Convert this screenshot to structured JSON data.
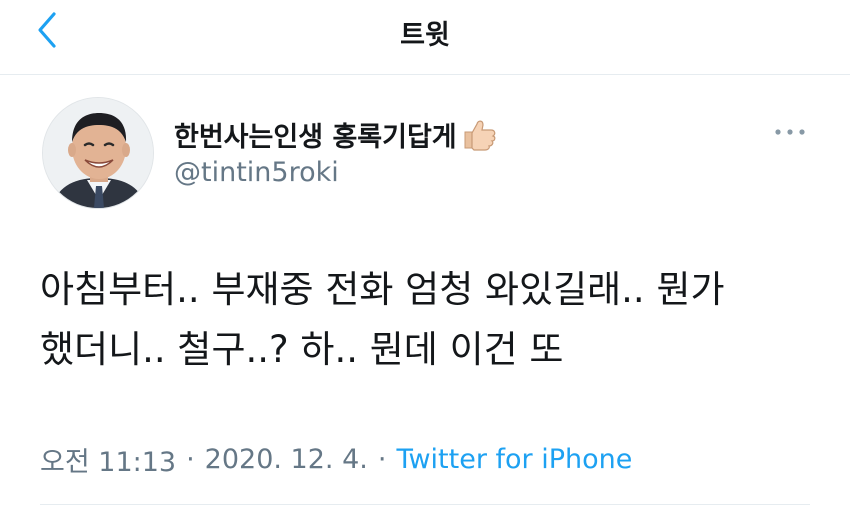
{
  "header": {
    "title": "트윗",
    "back_icon": "chevron-left-icon"
  },
  "tweet": {
    "author": {
      "display_name": "한번사는인생 홍록기답게",
      "handle": "@tintin5roki",
      "name_emoji": "thumbs-up-icon"
    },
    "text": "아침부터.. 부재중 전화 엄청 와있길래.. 뭔가 했더니.. 철구..? 하.. 뭔데 이건 또",
    "time": "오전 11:13",
    "date": "2020. 12. 4.",
    "separator": "·",
    "source": "Twitter for iPhone"
  },
  "colors": {
    "accent": "#1da1f2",
    "text": "#14171a",
    "secondary": "#657786",
    "divider": "#e6ecf0"
  }
}
